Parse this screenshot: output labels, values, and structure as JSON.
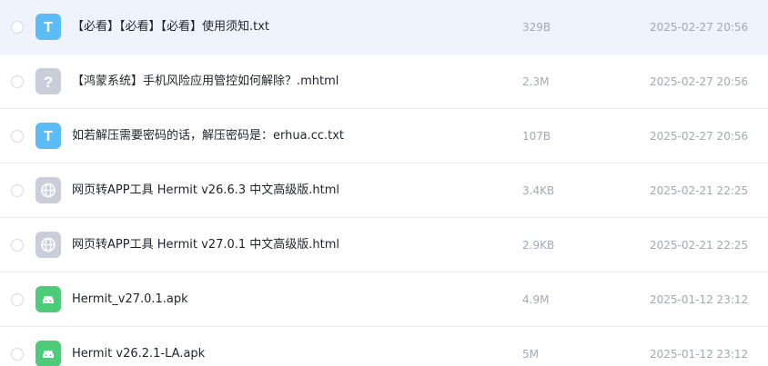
{
  "files": [
    {
      "name": "【必看】【必看】【必看】使用须知.txt",
      "size": "329B",
      "date": "2025-02-27 20:56",
      "icon": "txt-file-icon",
      "selected": true
    },
    {
      "name": "【鸿蒙系统】手机风险应用管控如何解除？.mhtml",
      "size": "2.3M",
      "date": "2025-02-27 20:56",
      "icon": "unknown-file-icon",
      "selected": false
    },
    {
      "name": "如若解压需要密码的话，解压密码是：erhua.cc.txt",
      "size": "107B",
      "date": "2025-02-27 20:56",
      "icon": "txt-file-icon",
      "selected": false
    },
    {
      "name": "网页转APP工具 Hermit v26.6.3 中文高级版.html",
      "size": "3.4KB",
      "date": "2025-02-21 22:25",
      "icon": "web-file-icon",
      "selected": false
    },
    {
      "name": "网页转APP工具 Hermit v27.0.1 中文高级版.html",
      "size": "2.9KB",
      "date": "2025-02-21 22:25",
      "icon": "web-file-icon",
      "selected": false
    },
    {
      "name": "Hermit_v27.0.1.apk",
      "size": "4.9M",
      "date": "2025-01-12 23:12",
      "icon": "android-file-icon",
      "selected": false
    },
    {
      "name": "Hermit v26.2.1-LA.apk",
      "size": "5M",
      "date": "2025-01-12 23:12",
      "icon": "android-file-icon",
      "selected": false
    }
  ],
  "icon_letters": {
    "txt": "T",
    "unknown": "?"
  },
  "colors": {
    "selected_row_bg": "#eef3fe",
    "txt_icon": "#5bbcf6",
    "unknown_icon": "#c9ced8",
    "web_icon": "#c9ced8",
    "apk_icon": "#4ecb78",
    "name_text": "#1f2329",
    "meta_text": "#a3a8b2"
  }
}
